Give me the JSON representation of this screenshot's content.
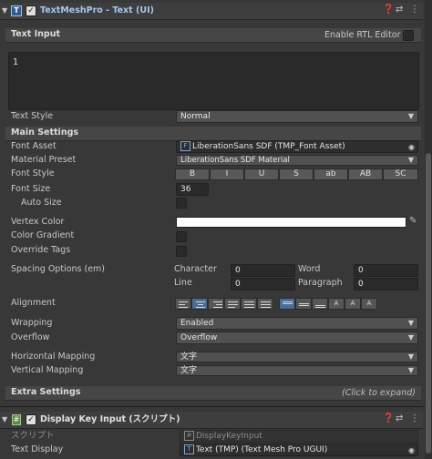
{
  "component1": {
    "title": "TextMeshPro - Text (UI)",
    "icon": "text-component-icon",
    "header_icons": [
      "help-icon",
      "preset-icon",
      "more-menu-icon"
    ]
  },
  "text_input": {
    "label": "Text Input",
    "rtl_label": "Enable RTL Editor",
    "value": "1"
  },
  "text_style": {
    "label": "Text Style",
    "value": "Normal"
  },
  "main_settings": {
    "title": "Main Settings",
    "font_asset": {
      "label": "Font Asset",
      "value": "LiberationSans SDF (TMP_Font Asset)"
    },
    "material_preset": {
      "label": "Material Preset",
      "value": "LiberationSans SDF Material"
    },
    "font_style": {
      "label": "Font Style",
      "buttons": [
        "B",
        "I",
        "U",
        "S",
        "ab",
        "AB",
        "SC"
      ]
    },
    "font_size": {
      "label": "Font Size",
      "value": "36"
    },
    "auto_size": {
      "label": "Auto Size"
    },
    "vertex_color": {
      "label": "Vertex Color",
      "color": "#ffffff"
    },
    "color_gradient": {
      "label": "Color Gradient"
    },
    "override_tags": {
      "label": "Override Tags"
    },
    "spacing": {
      "label": "Spacing Options (em)",
      "character": {
        "label": "Character",
        "value": "0"
      },
      "word": {
        "label": "Word",
        "value": "0"
      },
      "line": {
        "label": "Line",
        "value": "0"
      },
      "paragraph": {
        "label": "Paragraph",
        "value": "0"
      }
    },
    "alignment": {
      "label": "Alignment"
    },
    "wrapping": {
      "label": "Wrapping",
      "value": "Enabled"
    },
    "overflow": {
      "label": "Overflow",
      "value": "Overflow"
    },
    "horizontal_mapping": {
      "label": "Horizontal Mapping",
      "value": "文字"
    },
    "vertical_mapping": {
      "label": "Vertical Mapping",
      "value": "文字"
    }
  },
  "extra_settings": {
    "title": "Extra Settings",
    "hint": "(Click to expand)"
  },
  "component2": {
    "title": "Display Key Input (スクリプト)",
    "script_label": "スクリプト",
    "script_value": "DisplayKeyInput",
    "text_display_label": "Text Display",
    "text_display_value": "Text (TMP) (Text Mesh Pro UGUI)"
  },
  "colors": {
    "accent": "#4a6c96",
    "background": "#383838",
    "title_text": "#a6c8f0"
  }
}
